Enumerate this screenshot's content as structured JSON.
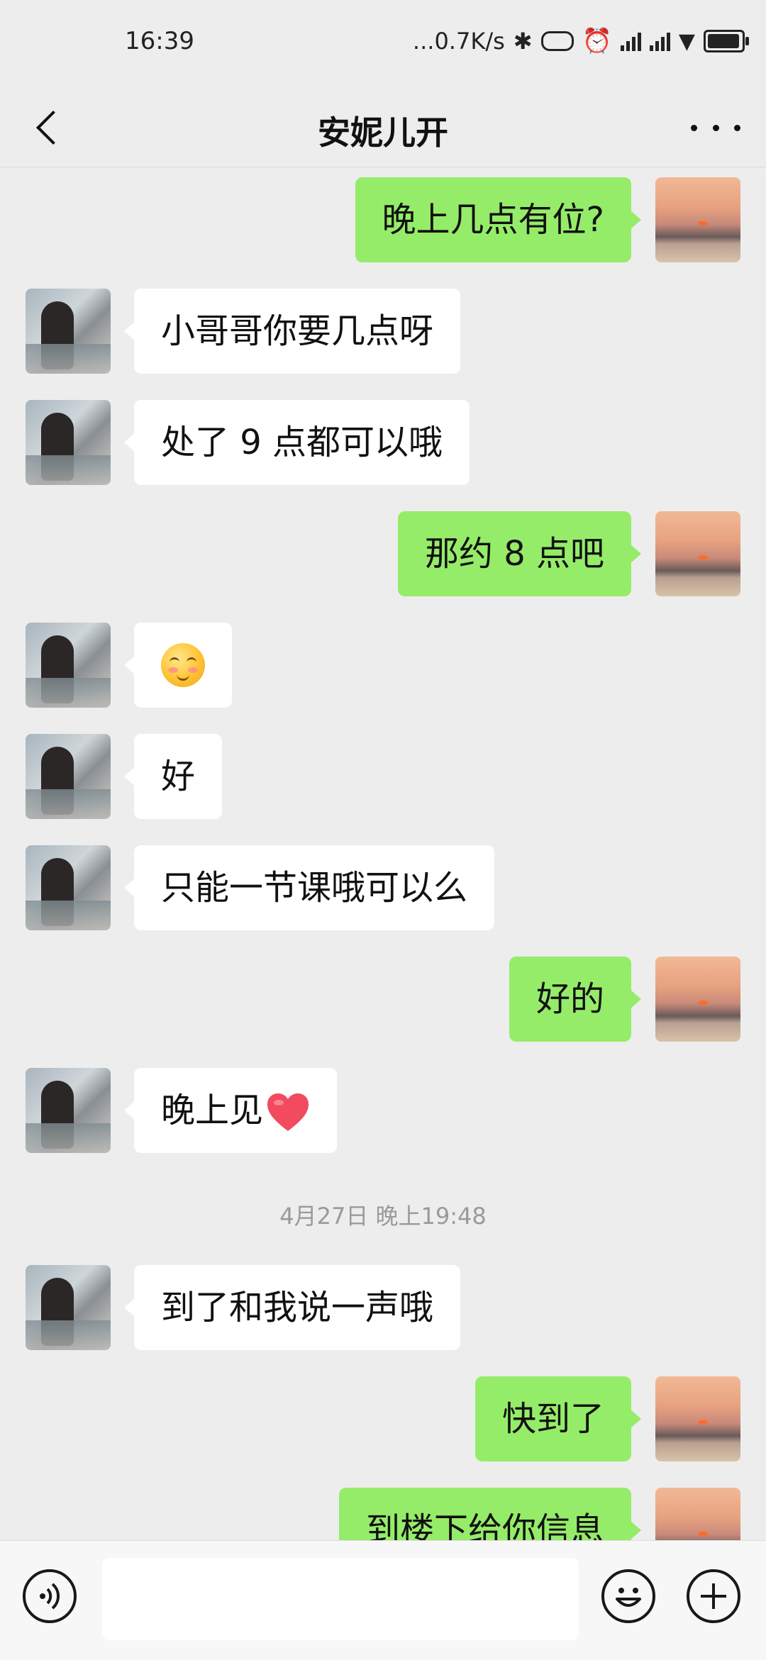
{
  "status_bar": {
    "time": "16:39",
    "network_speed": "...0.7K/s",
    "icons": [
      "bluetooth-icon",
      "vibrate-icon",
      "alarm-icon",
      "signal-icon",
      "hd-signal-icon",
      "wifi-icon",
      "battery-icon"
    ],
    "battery_level": "85"
  },
  "header": {
    "title": "安妮儿开",
    "back_icon": "chevron-left-icon",
    "more_icon": "ellipsis-icon"
  },
  "messages": [
    {
      "from": "me",
      "text": "晚上几点有位?"
    },
    {
      "from": "them",
      "text": "小哥哥你要几点呀"
    },
    {
      "from": "them",
      "text": "处了 9 点都可以哦"
    },
    {
      "from": "me",
      "text": "那约 8 点吧"
    },
    {
      "from": "them",
      "text": "",
      "emoji": "blushing-smile-emoji"
    },
    {
      "from": "them",
      "text": "好"
    },
    {
      "from": "them",
      "text": "只能一节课哦可以么"
    },
    {
      "from": "me",
      "text": "好的"
    },
    {
      "from": "them",
      "text": "晚上见",
      "emoji": "red-heart-emoji"
    },
    {
      "from": "them",
      "text": "到了和我说一声哦"
    },
    {
      "from": "me",
      "text": "快到了"
    },
    {
      "from": "me",
      "text": "到楼下给你信息"
    }
  ],
  "timestamp": "4月27日 晚上19:48",
  "input_bar": {
    "voice_icon": "voice-icon",
    "emoji_icon": "smiley-icon",
    "plus_icon": "plus-icon",
    "input_value": ""
  },
  "colors": {
    "background": "#ededed",
    "my_bubble": "#95ec69",
    "their_bubble": "#ffffff",
    "timestamp": "#9a9a9a"
  }
}
